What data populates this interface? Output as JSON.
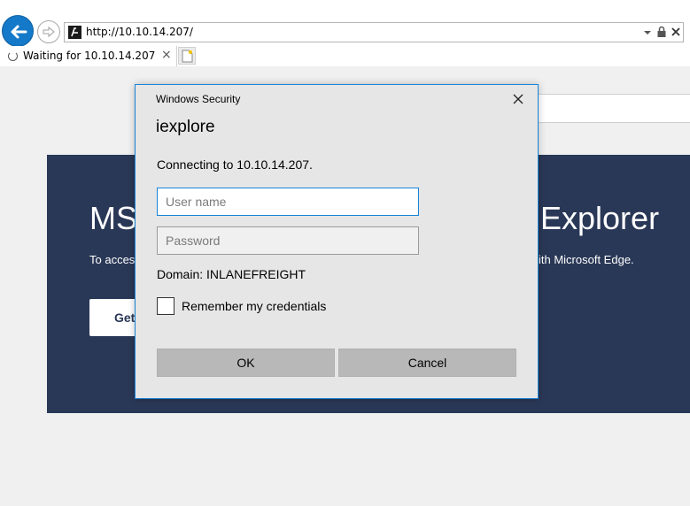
{
  "browser": {
    "url": "http://10.10.14.207/",
    "tab_title": "Waiting for 10.10.14.207",
    "tab_close": "×"
  },
  "page": {
    "banner_title_left": "MS",
    "banner_title_right": "Explorer",
    "banner_sub_left": "To acces",
    "banner_sub_right": "ith Microsoft Edge.",
    "banner_button": "Get",
    "banner_color": "#2a3857"
  },
  "dialog": {
    "caption": "Windows Security",
    "app_name": "iexplore",
    "message": "Connecting to 10.10.14.207.",
    "username_placeholder": "User name",
    "password_placeholder": "Password",
    "domain": "Domain: INLANEFREIGHT",
    "remember_label": "Remember my credentials",
    "ok_label": "OK",
    "cancel_label": "Cancel",
    "accent_color": "#1883d7"
  }
}
